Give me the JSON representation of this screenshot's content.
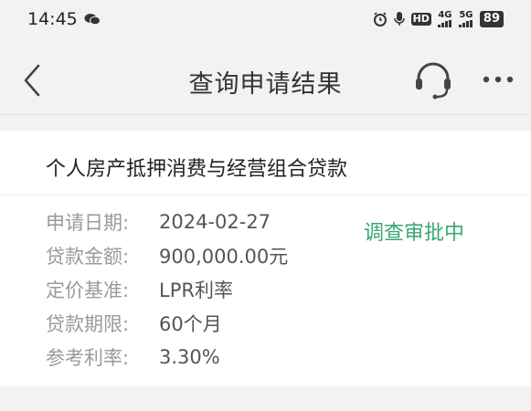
{
  "status_bar": {
    "time": "14:45",
    "hd_label": "HD",
    "net_4g": "4G",
    "net_5g": "5G",
    "battery": "89"
  },
  "nav": {
    "title": "查询申请结果"
  },
  "loan": {
    "name": "个人房产抵押消费与经营组合贷款",
    "status": "调查审批中",
    "status_color": "#3aa675",
    "fields": [
      {
        "label": "申请日期:",
        "value": "2024-02-27"
      },
      {
        "label": "贷款金额:",
        "value": "900,000.00元"
      },
      {
        "label": "定价基准:",
        "value": "LPR利率"
      },
      {
        "label": "贷款期限:",
        "value": "60个月"
      },
      {
        "label": "参考利率:",
        "value": "3.30%"
      }
    ]
  },
  "icons": {
    "back": "chevron-left-icon",
    "support": "headset-icon",
    "more": "more-icon",
    "chat": "wechat-icon",
    "alarm": "alarm-icon",
    "mic": "mic-icon",
    "signal": "signal-icon"
  }
}
